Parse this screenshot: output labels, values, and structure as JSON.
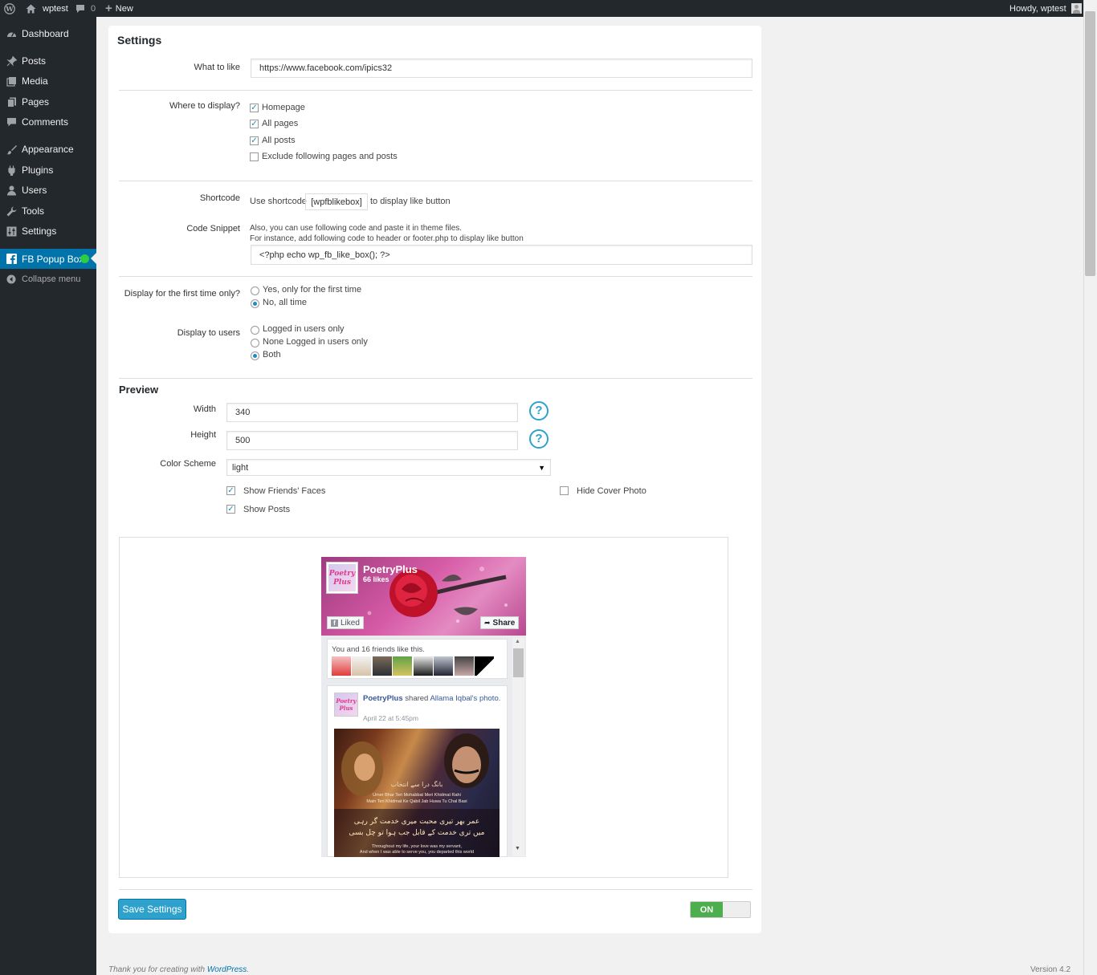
{
  "admin_bar": {
    "site_name": "wptest",
    "comments_count": "0",
    "new_label": "New",
    "howdy": "Howdy, wptest"
  },
  "menu": {
    "items": [
      {
        "label": "Dashboard",
        "icon": "dashboard-icon"
      },
      {
        "label": "Posts",
        "icon": "pin-icon"
      },
      {
        "label": "Media",
        "icon": "media-icon"
      },
      {
        "label": "Pages",
        "icon": "page-icon"
      },
      {
        "label": "Comments",
        "icon": "comment-icon"
      },
      {
        "label": "Appearance",
        "icon": "brush-icon"
      },
      {
        "label": "Plugins",
        "icon": "plug-icon"
      },
      {
        "label": "Users",
        "icon": "user-icon"
      },
      {
        "label": "Tools",
        "icon": "wrench-icon"
      },
      {
        "label": "Settings",
        "icon": "sliders-icon"
      },
      {
        "label": "FB Popup Box",
        "icon": "facebook-icon"
      }
    ],
    "collapse": "Collapse menu"
  },
  "settings": {
    "title": "Settings",
    "what_to_like_label": "What to like",
    "what_to_like_value": "https://www.facebook.com/ipics32",
    "where_label": "Where to display?",
    "where_options": [
      {
        "label": "Homepage",
        "checked": true
      },
      {
        "label": "All pages",
        "checked": true
      },
      {
        "label": "All posts",
        "checked": true
      },
      {
        "label": "Exclude following pages and posts",
        "checked": false
      }
    ],
    "shortcode_label": "Shortcode",
    "shortcode_pre": "Use shortcode",
    "shortcode_code": "[wpfblikebox]",
    "shortcode_post": "to display like button",
    "snippet_label": "Code Snippet",
    "snippet_line1": "Also, you can use following code and paste it in theme files.",
    "snippet_line2": "For instance, add following code to header or footer.php to display like button",
    "snippet_code": "<?php echo wp_fb_like_box(); ?>",
    "first_time_label": "Display for the first time only?",
    "first_time_options": [
      {
        "label": "Yes, only for the first time",
        "selected": false
      },
      {
        "label": "No, all time",
        "selected": true
      }
    ],
    "users_label": "Display to users",
    "users_options": [
      {
        "label": "Logged in users only",
        "selected": false
      },
      {
        "label": "None Logged in users only",
        "selected": false
      },
      {
        "label": "Both",
        "selected": true
      }
    ]
  },
  "preview": {
    "title": "Preview",
    "width_label": "Width",
    "width_value": "340",
    "height_label": "Height",
    "height_value": "500",
    "scheme_label": "Color Scheme",
    "scheme_value": "light",
    "show_faces": "Show Friends' Faces",
    "show_faces_checked": true,
    "show_posts": "Show Posts",
    "show_posts_checked": true,
    "hide_cover": "Hide Cover Photo",
    "hide_cover_checked": false,
    "help_glyph": "?"
  },
  "fb": {
    "page_name": "PoetryPlus",
    "likes": "66 likes",
    "liked": "Liked",
    "share": "Share",
    "friends_text": "You and 16 friends like this.",
    "post_author": "PoetryPlus",
    "post_action": "shared",
    "post_target": "Allama Iqbal's",
    "post_object": "photo.",
    "post_time": "April 22 at 5:45pm",
    "post_img_line1": "Umer Bhar Teri Mohabbat Meri Khidmat Rahi",
    "post_img_line2": "Main Teri Khidmat Ke Qabil Jab Huwa Tu Chal Basi",
    "post_img_line3": "Throughout my life, your love was my servant,",
    "post_img_line4": "And when I was able to serve you, you departed this world",
    "logo_text": "Poetry Plus"
  },
  "actions": {
    "save": "Save Settings",
    "toggle": "ON"
  },
  "footer": {
    "thanks": "Thank you for creating with",
    "wp_link": "WordPress",
    "version": "Version 4.2"
  }
}
